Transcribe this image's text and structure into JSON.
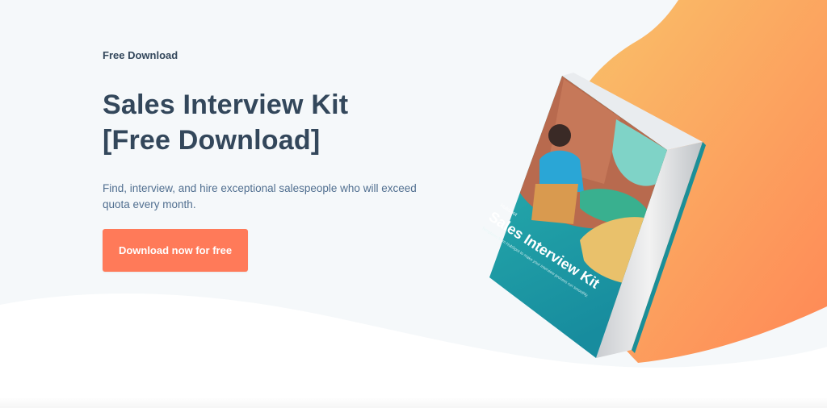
{
  "hero": {
    "eyebrow": "Free Download",
    "title_line1": "Sales Interview Kit",
    "title_line2": "[Free Download]",
    "description": "Find, interview, and hire exceptional salespeople who will exceed quota every month.",
    "cta_label": "Download now for free"
  },
  "book": {
    "logo_text": "HubSpot",
    "title": "Sales Interview Kit",
    "subtitle": "Templates from HubSpot to make your interview process run smoothly."
  },
  "colors": {
    "background": "#f5f8fa",
    "accent": "#ff7a59",
    "heading": "#33475b",
    "blob_start": "#f8bf66",
    "blob_end": "#ff8c5a",
    "book_teal": "#1fa3a8"
  }
}
